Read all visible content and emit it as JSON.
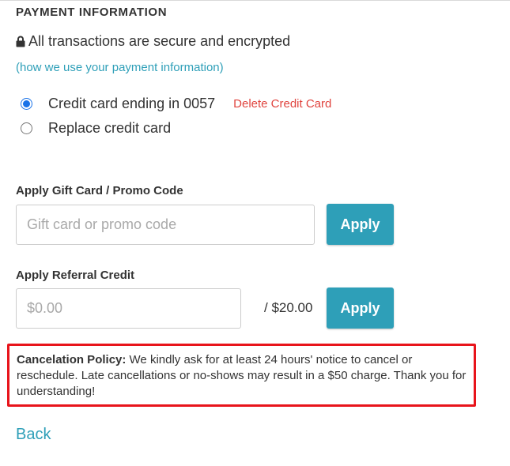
{
  "payment": {
    "section_title": "PAYMENT INFORMATION",
    "secure_text": "All transactions are secure and encrypted",
    "info_link": "(how we use your payment information)",
    "options": [
      {
        "label": "Credit card ending in 0057",
        "selected": true
      },
      {
        "label": "Replace credit card",
        "selected": false
      }
    ],
    "delete_link": "Delete Credit Card"
  },
  "promo": {
    "label": "Apply Gift Card / Promo Code",
    "placeholder": "Gift card or promo code",
    "value": "",
    "button": "Apply"
  },
  "referral": {
    "label": "Apply Referral Credit",
    "placeholder": "$0.00",
    "value": "",
    "max_credit": "/ $20.00",
    "button": "Apply"
  },
  "policy": {
    "label": "Cancelation Policy:",
    "text": "We kindly ask for at least 24 hours' notice to cancel or reschedule. Late cancellations or no-shows may result in a $50 charge. Thank you for understanding!"
  },
  "back_link": "Back",
  "colors": {
    "accent": "#2e9fb8",
    "danger": "#e0443e",
    "highlight_border": "#e8141b",
    "radio_checked": "#1a73e8"
  },
  "icons": {
    "lock": "lock-icon"
  }
}
